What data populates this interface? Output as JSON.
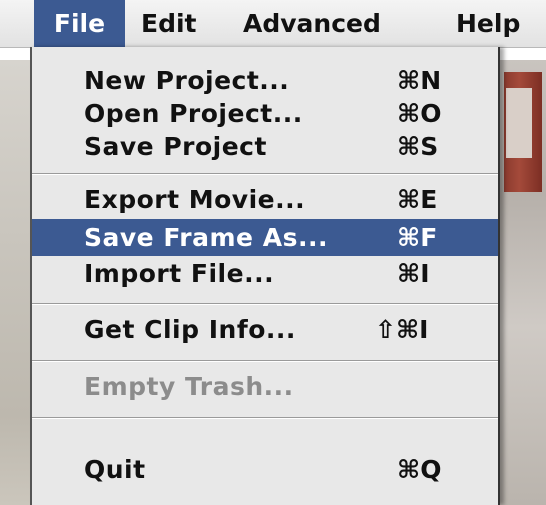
{
  "menubar": {
    "items": [
      "File",
      "Edit",
      "Advanced",
      "Help"
    ]
  },
  "file_menu": {
    "items": [
      {
        "label": "New Project...",
        "shortcut": "⌘N"
      },
      {
        "label": "Open Project...",
        "shortcut": "⌘O"
      },
      {
        "label": "Save Project",
        "shortcut": "⌘S"
      },
      {
        "label": "Export Movie...",
        "shortcut": "⌘E"
      },
      {
        "label": "Save Frame As...",
        "shortcut": "⌘F"
      },
      {
        "label": "Import File...",
        "shortcut": "⌘I"
      },
      {
        "label": "Get Clip Info...",
        "shortcut": "⇧⌘I"
      },
      {
        "label": "Empty Trash...",
        "shortcut": ""
      },
      {
        "label": "Quit",
        "shortcut": "⌘Q"
      }
    ],
    "highlighted_item": "Save Frame As...",
    "disabled_item": "Empty Trash...",
    "highlight_color": "#3c5a92"
  }
}
